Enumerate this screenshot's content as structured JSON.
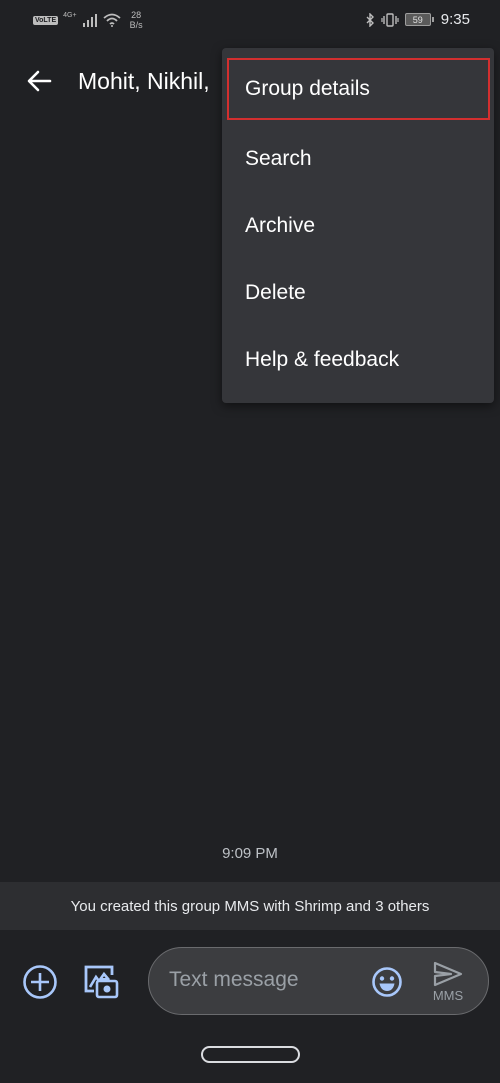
{
  "status_bar": {
    "volte": "VoLTE",
    "network": "4G+",
    "speed_value": "28",
    "speed_unit": "B/s",
    "battery": "59",
    "time": "9:35"
  },
  "app_bar": {
    "title": "Mohit, Nikhil,",
    "back_icon": "arrow-left-icon"
  },
  "menu": {
    "items": [
      {
        "label": "Group details",
        "highlighted": true
      },
      {
        "label": "Search"
      },
      {
        "label": "Archive"
      },
      {
        "label": "Delete"
      },
      {
        "label": "Help & feedback"
      }
    ],
    "highlight_color": "#d32f2f"
  },
  "conversation": {
    "timestamp": "9:09 PM",
    "system_message": "You created this group MMS with Shrimp  and 3 others"
  },
  "compose": {
    "placeholder": "Text message",
    "value": "",
    "send_label": "MMS",
    "icons": [
      "add-circle-icon",
      "gallery-camera-icon",
      "emoji-icon",
      "send-icon"
    ],
    "accent_color": "#a8c7fa"
  }
}
